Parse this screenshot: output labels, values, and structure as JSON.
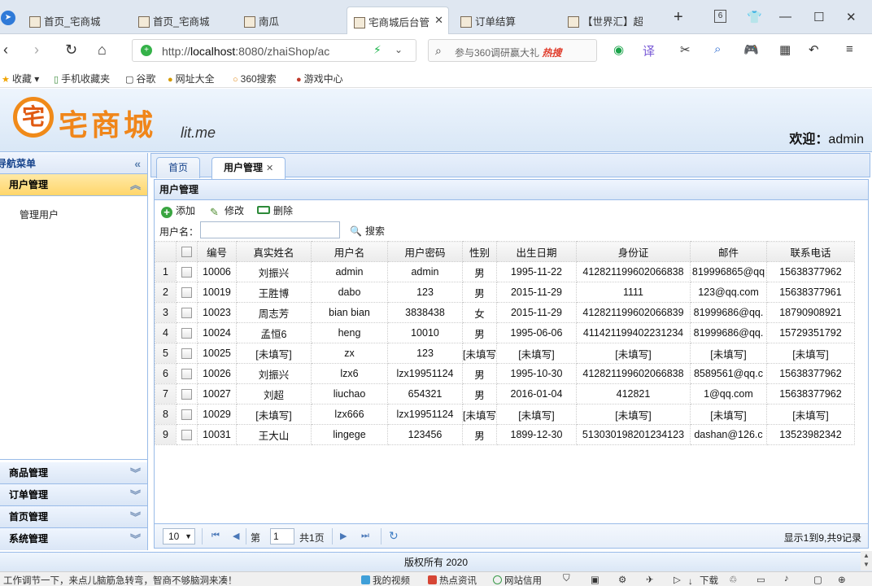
{
  "browser": {
    "tabs": [
      {
        "label": "首页_宅商城",
        "active": false
      },
      {
        "label": "首页_宅商城",
        "active": false
      },
      {
        "label": "南瓜",
        "active": false
      },
      {
        "label": "宅商城后台管",
        "active": true
      },
      {
        "label": "订单结算",
        "active": false
      },
      {
        "label": "【世界汇】超",
        "active": false
      }
    ],
    "tab_count": "6",
    "url_host": "localhost",
    "url_prefix": "http://",
    "url_rest": ":8080/zhaiShop/ac",
    "search_text": "参与360调研赢大礼",
    "search_hot": "热搜",
    "bookmarks": [
      "收藏",
      "手机收藏夹",
      "谷歌",
      "网址大全",
      "360搜索",
      "游戏中心"
    ]
  },
  "header": {
    "logo_text": "宅商城",
    "logo_sub": "lit.me",
    "welcome_label": "欢迎：",
    "welcome_user": "admin"
  },
  "nav": {
    "title": "导航菜单",
    "sections": [
      {
        "label": "用户管理",
        "expanded": true,
        "items": [
          "管理用户"
        ]
      },
      {
        "label": "商品管理",
        "expanded": false
      },
      {
        "label": "订单管理",
        "expanded": false
      },
      {
        "label": "首页管理",
        "expanded": false
      },
      {
        "label": "系统管理",
        "expanded": false
      }
    ]
  },
  "center": {
    "tabs": [
      {
        "label": "首页",
        "active": false
      },
      {
        "label": "用户管理",
        "active": true
      }
    ],
    "panel_title": "用户管理",
    "toolbar": {
      "add": "添加",
      "edit": "修改",
      "delete": "删除"
    },
    "search": {
      "label": "用户名：",
      "value": "",
      "button": "搜索"
    },
    "columns": [
      "编号",
      "真实姓名",
      "用户名",
      "用户密码",
      "性别",
      "出生日期",
      "身份证",
      "邮件",
      "联系电话"
    ],
    "rows": [
      [
        "10006",
        "刘振兴",
        "admin",
        "admin",
        "男",
        "1995-11-22",
        "412821199602066838",
        "819996865@qq",
        "15638377962"
      ],
      [
        "10019",
        "王胜博",
        "dabo",
        "123",
        "男",
        "2015-11-29",
        "1111",
        "123@qq.com",
        "15638377961"
      ],
      [
        "10023",
        "周志芳",
        "bian bian",
        "3838438",
        "女",
        "2015-11-29",
        "412821199602066839",
        "81999686@qq.",
        "18790908921"
      ],
      [
        "10024",
        "孟恒6",
        "heng",
        "10010",
        "男",
        "1995-06-06",
        "411421199402231234",
        "81999686@qq.",
        "15729351792"
      ],
      [
        "10025",
        "[未填写]",
        "zx",
        "123",
        "[未填写",
        "[未填写]",
        "[未填写]",
        "[未填写]",
        "[未填写]"
      ],
      [
        "10026",
        "刘振兴",
        "lzx6",
        "lzx19951124",
        "男",
        "1995-10-30",
        "412821199602066838",
        "8589561@qq.c",
        "15638377962"
      ],
      [
        "10027",
        "刘超",
        "liuchao",
        "654321",
        "男",
        "2016-01-04",
        "412821",
        "1@qq.com",
        "15638377962"
      ],
      [
        "10029",
        "[未填写]",
        "lzx666",
        "lzx19951124",
        "[未填写",
        "[未填写]",
        "[未填写]",
        "[未填写]",
        "[未填写]"
      ],
      [
        "10031",
        "王大山",
        "lingege",
        "123456",
        "男",
        "1899-12-30",
        "513030198201234123",
        "dashan@126.c",
        "13523982342"
      ]
    ],
    "pager": {
      "page_size": "10",
      "page_label": "第",
      "page_value": "1",
      "total_pages": "共1页",
      "info": "显示1到9,共9记录"
    }
  },
  "footer": {
    "copyright": "版权所有 2020"
  },
  "statusbar": {
    "ticker": "工作调节一下，来点儿脑筋急转弯，智商不够脑洞来凑！",
    "items": [
      "我的视频",
      "热点资讯",
      "网站信用",
      "下载"
    ]
  },
  "colors": {
    "border": "#99bbe8",
    "selected_header": "#ffd66b",
    "title_text": "#15428b"
  }
}
